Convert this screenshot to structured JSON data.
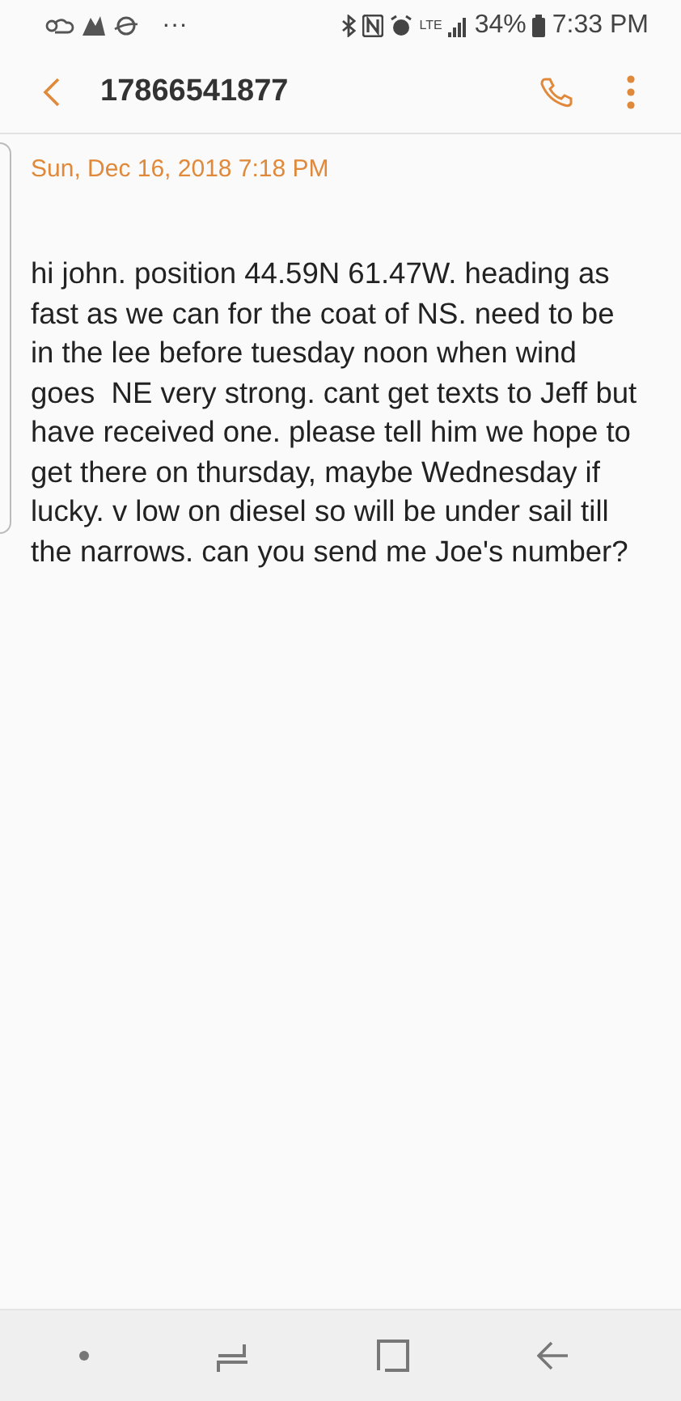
{
  "status_bar": {
    "overflow": "···",
    "network": "LTE",
    "battery": "34%",
    "time": "7:33 PM"
  },
  "header": {
    "title": "17866541877"
  },
  "message": {
    "timestamp": "Sun, Dec 16, 2018 7:18 PM",
    "text": "hi john. position 44.59N 61.47W. heading as fast as we can for the coat of NS. need to be in the lee before tuesday noon when wind goes  NE very strong. cant get texts to Jeff but have received one. please tell him we hope to get there on thursday, maybe Wednesday if lucky. v low on diesel so will be under sail till the narrows. can you send me Joe's number?"
  }
}
